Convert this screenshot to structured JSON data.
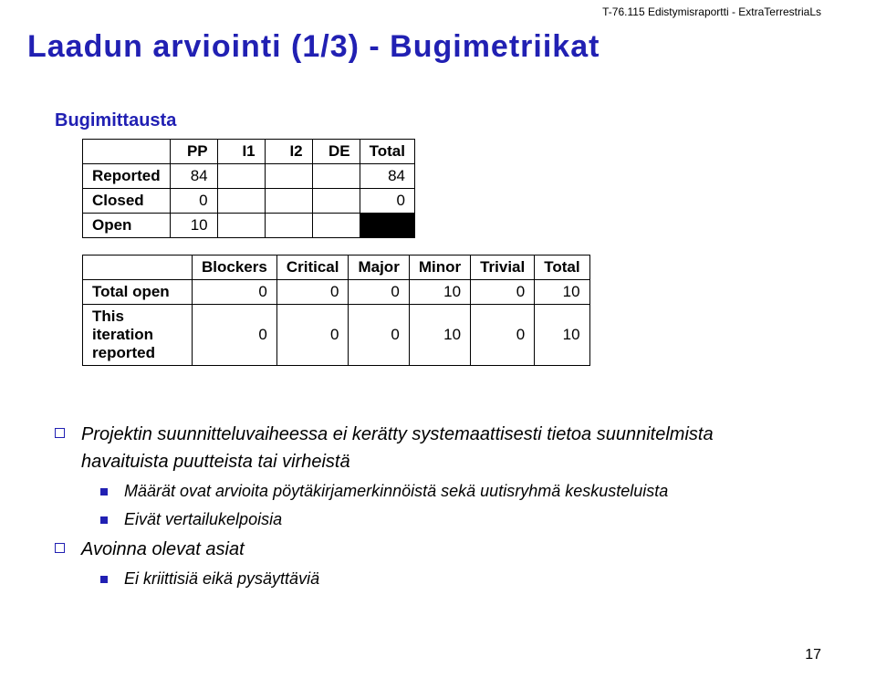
{
  "header": {
    "right": "T-76.115 Edistymisraportti - ExtraTerrestriaLs"
  },
  "title": "Laadun arviointi (1/3) - Bugimetriikat",
  "subheading": "Bugimittausta",
  "table1": {
    "cols": [
      "",
      "PP",
      "I1",
      "I2",
      "DE",
      "Total"
    ],
    "rows": [
      {
        "label": "Reported",
        "cells": [
          "84",
          "",
          "",
          "",
          "84"
        ]
      },
      {
        "label": "Closed",
        "cells": [
          "0",
          "",
          "",
          "",
          "0"
        ]
      },
      {
        "label": "Open",
        "cells": [
          "10",
          "",
          "",
          "",
          ""
        ],
        "blackLast": true
      }
    ]
  },
  "table2": {
    "cols": [
      "",
      "Blockers",
      "Critical",
      "Major",
      "Minor",
      "Trivial",
      "Total"
    ],
    "rows": [
      {
        "label": "Total open",
        "cells": [
          "0",
          "0",
          "0",
          "10",
          "0",
          "10"
        ]
      },
      {
        "label": "This iteration reported",
        "cells": [
          "0",
          "0",
          "0",
          "10",
          "0",
          "10"
        ]
      }
    ]
  },
  "bullets": {
    "b1": "Projektin suunnitteluvaiheessa ei kerätty systemaattisesti tietoa suunnitelmista havaituista puutteista tai virheistä",
    "b1a": "Määrät ovat arvioita pöytäkirjamerkinnöistä sekä uutisryhmä keskusteluista",
    "b1b": "Eivät vertailukelpoisia",
    "b2": "Avoinna olevat asiat",
    "b2a": "Ei kriittisiä eikä pysäyttäviä"
  },
  "footer": {
    "page": "17"
  }
}
